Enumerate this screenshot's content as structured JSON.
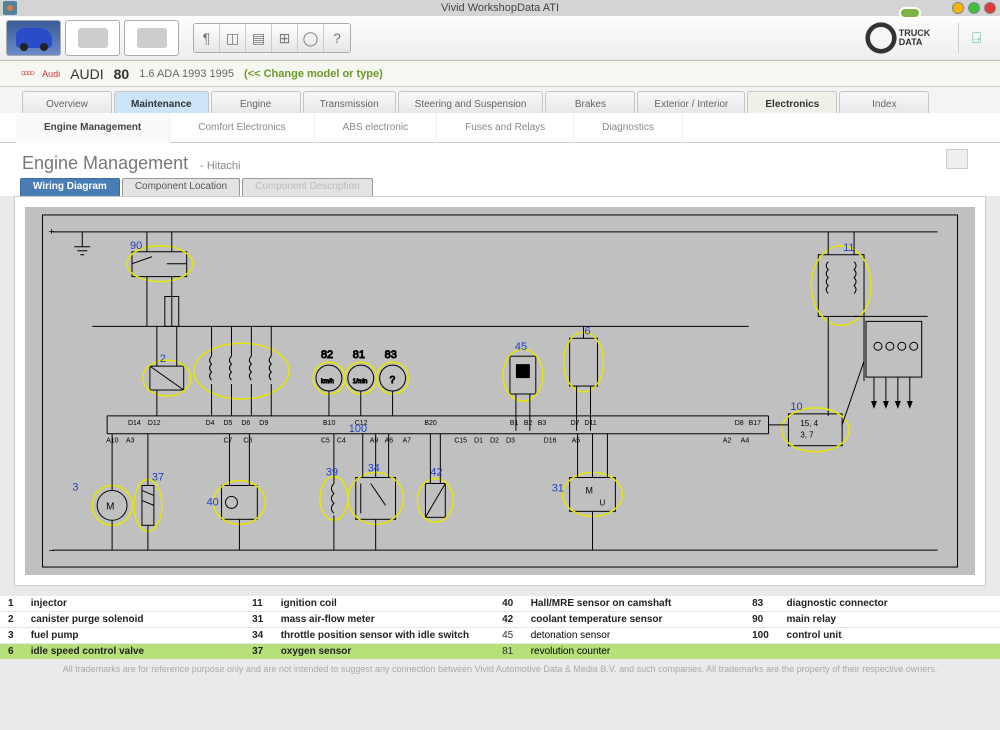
{
  "window": {
    "title": "Vivid WorkshopData ATI"
  },
  "brand": {
    "truck1": "TRUCK",
    "truck2": "DATA"
  },
  "model_bar": {
    "brand_text": "Audi",
    "make": "AUDI",
    "model": "80",
    "engine": "1.6 ADA 1993 1995",
    "change": "(<< Change model or type)"
  },
  "main_tabs": [
    "Overview",
    "Maintenance",
    "Engine",
    "Transmission",
    "Steering and Suspension",
    "Brakes",
    "Exterior / Interior",
    "Electronics",
    "Index"
  ],
  "main_tabs_active": 1,
  "main_tabs_active2": 7,
  "sub_tabs": [
    "Engine Management",
    "Comfort Electronics",
    "ABS electronic",
    "Fuses and Relays",
    "Diagnostics"
  ],
  "sub_tabs_active": 0,
  "section": {
    "title": "Engine Management",
    "subtitle": "- Hitachi"
  },
  "doc_tabs": [
    "Wiring Diagram",
    "Component Location",
    "Component Description"
  ],
  "doc_tabs_active": 0,
  "diagram_labels": {
    "top_refs": [
      "90",
      "11"
    ],
    "mid_refs": [
      "2",
      "82",
      "81",
      "83",
      "45",
      "6"
    ],
    "row1": [
      "D14",
      "D12",
      "D4",
      "D5",
      "D6",
      "D9",
      "B10",
      "C12",
      "B20",
      "B1",
      "B2",
      "B3",
      "D7",
      "D11",
      "D8",
      "B17"
    ],
    "row2": [
      "A10",
      "A3",
      "C7",
      "C8",
      "C5",
      "C4",
      "A9",
      "A6",
      "A7",
      "C15",
      "D1",
      "D2",
      "D3",
      "D16",
      "A5",
      "A2",
      "A4"
    ],
    "center": "100",
    "right_box": [
      "10",
      "15,  4",
      "3,   7"
    ],
    "bottom_refs": [
      "3",
      "37",
      "40",
      "39",
      "34",
      "42",
      "31"
    ]
  },
  "legend_cols": [
    [
      {
        "n": "1",
        "t": "injector",
        "b": true
      },
      {
        "n": "2",
        "t": "canister purge solenoid",
        "b": true
      },
      {
        "n": "3",
        "t": "fuel pump",
        "b": true
      },
      {
        "n": "6",
        "t": "idle speed control valve",
        "b": true
      }
    ],
    [
      {
        "n": "11",
        "t": "ignition coil",
        "b": true
      },
      {
        "n": "31",
        "t": "mass air-flow meter",
        "b": true
      },
      {
        "n": "34",
        "t": "throttle position sensor with idle switch",
        "b": true
      },
      {
        "n": "37",
        "t": "oxygen sensor",
        "b": true
      }
    ],
    [
      {
        "n": "40",
        "t": "Hall/MRE sensor on camshaft",
        "b": true
      },
      {
        "n": "42",
        "t": "coolant temperature sensor",
        "b": true
      },
      {
        "n": "45",
        "t": "detonation sensor",
        "b": false
      },
      {
        "n": "81",
        "t": "revolution counter",
        "b": false
      }
    ],
    [
      {
        "n": "83",
        "t": "diagnostic connector",
        "b": true
      },
      {
        "n": "90",
        "t": "main relay",
        "b": true
      },
      {
        "n": "100",
        "t": "control unit",
        "b": true
      },
      {
        "n": "",
        "t": "",
        "b": false
      }
    ]
  ],
  "disclaimer": "All trademarks are for reference purpose only and are not intended to suggest any connection between Vivid Automotive Data & Media B.V. and such companies. All trademarks are the property of their respective owners."
}
